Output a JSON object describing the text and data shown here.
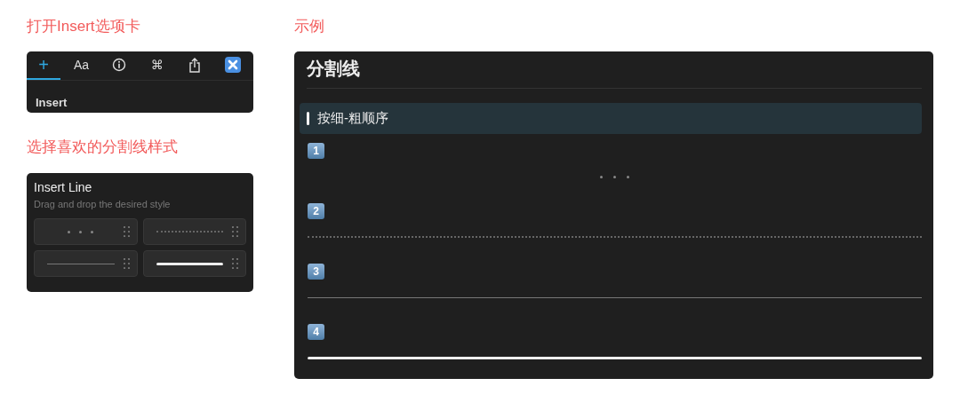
{
  "captions": {
    "step_1": "打开Insert选项卡",
    "step_2": "选择喜欢的分割线样式",
    "example": "示例"
  },
  "toolbar": {
    "tabs": [
      {
        "kind": "text",
        "label": "+",
        "selected": true
      },
      {
        "kind": "text",
        "label": "Aa",
        "selected": false
      },
      {
        "kind": "info",
        "selected": false
      },
      {
        "kind": "text",
        "label": "⌘",
        "selected": false
      },
      {
        "kind": "share",
        "selected": false
      },
      {
        "kind": "close",
        "selected": false
      }
    ],
    "section": "Insert"
  },
  "insert_line": {
    "title": "Insert Line",
    "hint": "Drag and drop the desired style",
    "styles": [
      {
        "kind": "dots"
      },
      {
        "kind": "dotted"
      },
      {
        "kind": "thin"
      },
      {
        "kind": "thick"
      }
    ]
  },
  "example": {
    "title": "分割线",
    "callout": "按细-粗顺序",
    "items": [
      {
        "number": "1",
        "kind": "dots"
      },
      {
        "number": "2",
        "kind": "dotted"
      },
      {
        "number": "3",
        "kind": "thin"
      },
      {
        "number": "4",
        "kind": "thick"
      }
    ]
  }
}
